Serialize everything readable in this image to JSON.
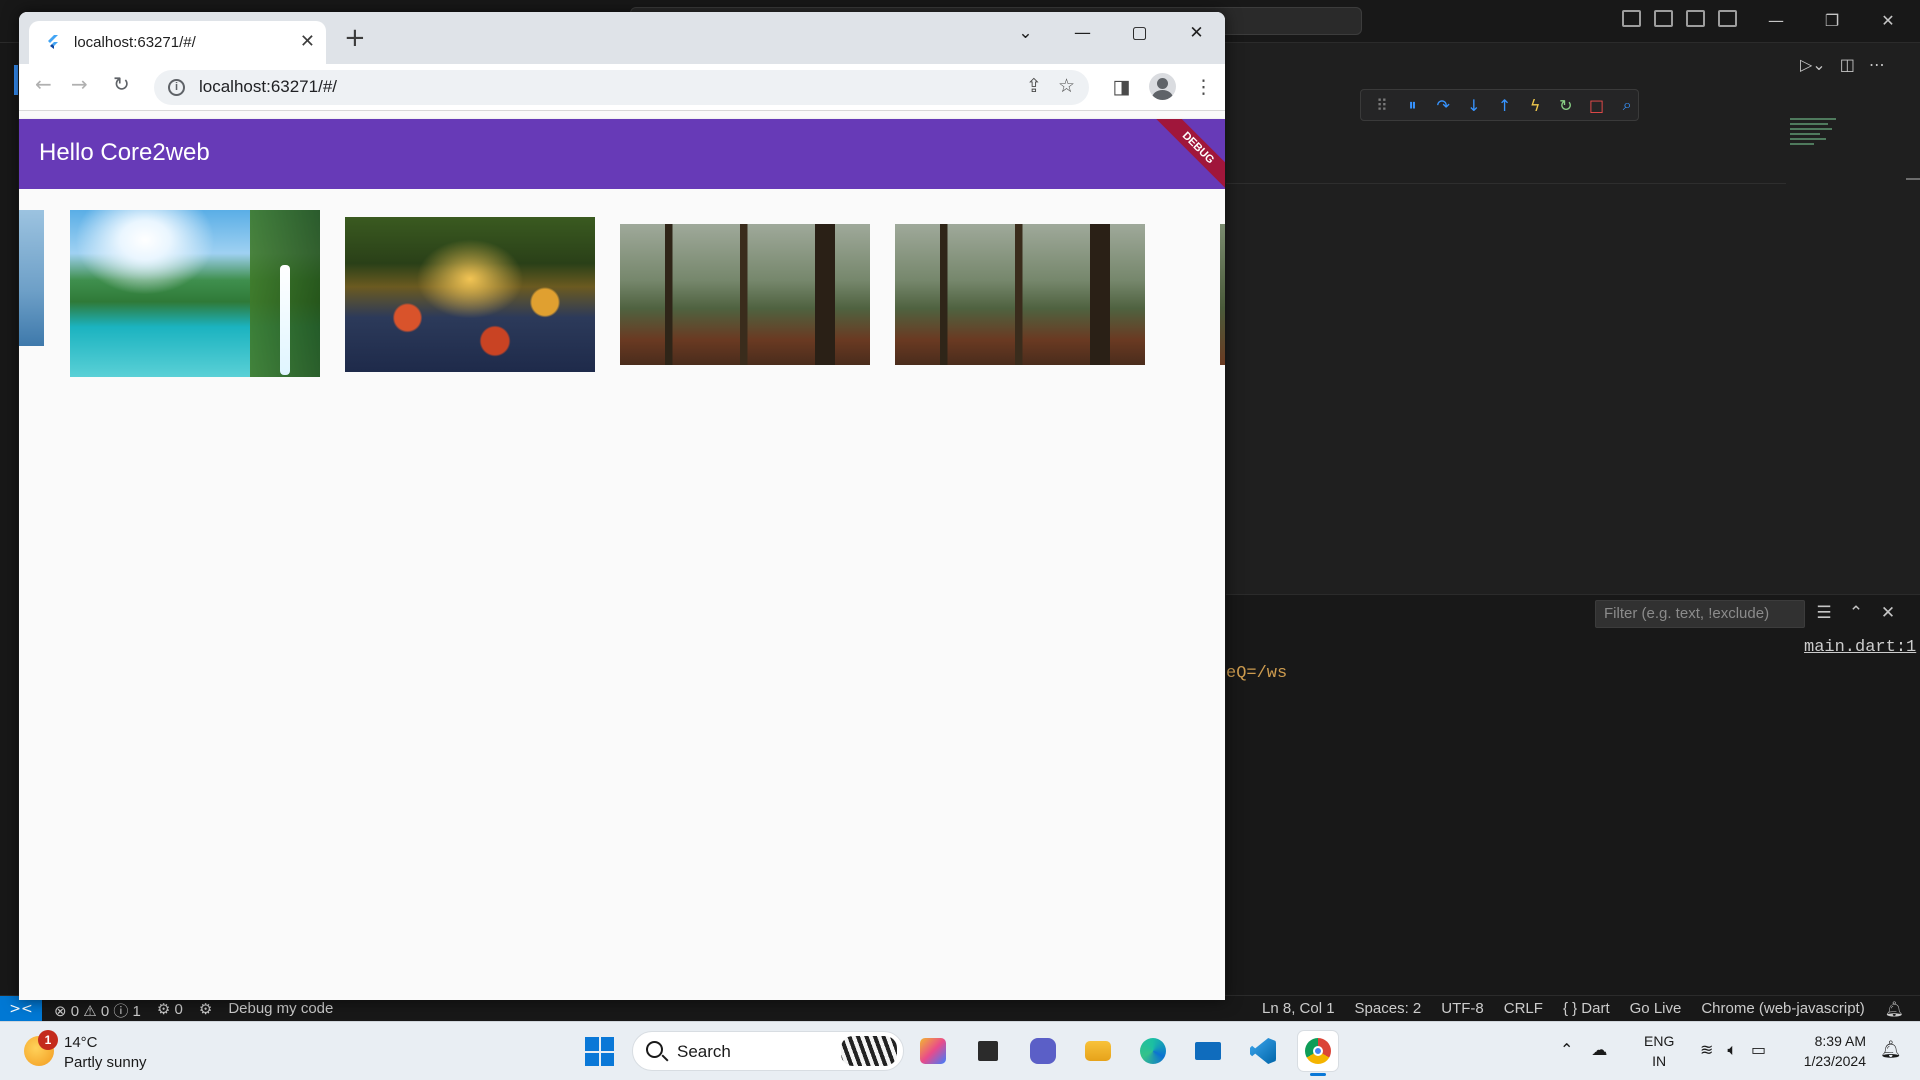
{
  "vscode": {
    "filter_placeholder": "Filter (e.g. text, !exclude)",
    "main_link": "main.dart:1",
    "console_text": "eQ=/ws",
    "status": {
      "remote": "><",
      "problems": "⊗ 0 ⚠ 0 ⓘ 1",
      "ports": "⚙ 0",
      "debug_label": "Debug my code",
      "ln_col": "Ln 8, Col 1",
      "spaces": "Spaces: 2",
      "encoding": "UTF-8",
      "eol": "CRLF",
      "language": "{ } Dart",
      "go_live": "Go Live",
      "device": "Chrome (web-javascript)"
    }
  },
  "chrome": {
    "tab_title": "localhost:63271/#/",
    "url": "localhost:63271/#/"
  },
  "app": {
    "title": "Hello Core2web",
    "debug_banner": "DEBUG",
    "images": [
      {
        "name": "partial-left-image",
        "scene": "waterfall"
      },
      {
        "name": "waterfall-lake-image",
        "scene": "waterfall"
      },
      {
        "name": "stream-rocks-image",
        "scene": "rocks"
      },
      {
        "name": "misty-forest-image",
        "scene": "forest"
      },
      {
        "name": "misty-forest-image-2",
        "scene": "forest"
      },
      {
        "name": "partial-right-image",
        "scene": "forest"
      }
    ]
  },
  "taskbar": {
    "weather_badge": "1",
    "temperature": "14°C",
    "condition": "Partly sunny",
    "search_label": "Search",
    "lang_1": "ENG",
    "lang_2": "IN",
    "time": "8:39 AM",
    "date": "1/23/2024"
  },
  "colors": {
    "app_bar": "#673ab7",
    "debug_banner": "#a0163b",
    "vscode_accent": "#0078d4"
  }
}
